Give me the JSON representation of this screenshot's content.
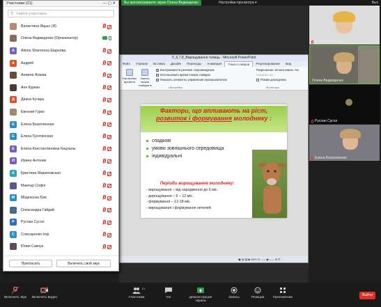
{
  "topbar": {
    "share_badge": "Вы просматриваете экран Олена Ведмеденко",
    "view_options": "Настройки просмотра ▾",
    "window_controls": "— ▢ ✕",
    "fullscreen_label": "Вых"
  },
  "participants": {
    "title": "Участники (21)",
    "window_controls": "— ▢ ✕",
    "search_placeholder": "Найти участника",
    "list": [
      {
        "name": "Валентина Яцько (Я)",
        "initial": "",
        "color": "#b88a6e",
        "status": "muted",
        "photo": true
      },
      {
        "name": "Олена Ведмеденко (Организатор)",
        "initial": "",
        "color": "#8a6a5a",
        "status": "active",
        "photo": true
      },
      {
        "name": "Aliona Sharonova Шарнова",
        "initial": "A",
        "color": "#7b5cc4",
        "status": "muted"
      },
      {
        "name": "Андрей",
        "initial": "А",
        "color": "#d9532c",
        "status": "muted"
      },
      {
        "name": "Анжела Агаева",
        "initial": "",
        "color": "#6a4a3a",
        "status": "muted",
        "photo": true
      },
      {
        "name": "Аня Куркан",
        "initial": "",
        "color": "#4a3a3a",
        "status": "muted",
        "photo": true
      },
      {
        "name": "Диана Кучарь",
        "initial": "Д",
        "color": "#d9532c",
        "status": "muted"
      },
      {
        "name": "Евгения Гурко",
        "initial": "",
        "color": "#9a8a7a",
        "status": "muted",
        "photo": true
      },
      {
        "name": "Елена Безатлинная",
        "initial": "Е",
        "color": "#2a8fc4",
        "status": "muted"
      },
      {
        "name": "Елена Гусятинская",
        "initial": "Е",
        "color": "#2a8fc4",
        "status": "muted"
      },
      {
        "name": "Елена Константиновна Кицлалы",
        "initial": "Е",
        "color": "#7b5cc4",
        "status": "muted"
      },
      {
        "name": "Ирина Антоник",
        "initial": "И",
        "color": "#7b5cc4",
        "status": "muted"
      },
      {
        "name": "Кристина Мажиловская",
        "initial": "К",
        "color": "#2aa8b4",
        "status": "muted"
      },
      {
        "name": "Мамчур Софія",
        "initial": "",
        "color": "#5a5a8a",
        "status": "muted",
        "photo": true
      },
      {
        "name": "Міщенська Єва",
        "initial": "М",
        "color": "#2a8fc4",
        "status": "muted"
      },
      {
        "name": "Олександра Гайдай",
        "initial": "",
        "color": "#4a6a8a",
        "status": "muted",
        "photo": true
      },
      {
        "name": "Руслан Сусол",
        "initial": "Р",
        "color": "#2a6fc4",
        "status": "muted"
      },
      {
        "name": "Слюсаренко Ігор",
        "initial": "С",
        "color": "#2a8fc4",
        "status": "muted"
      },
      {
        "name": "Юлия Савчук",
        "initial": "",
        "color": "#5a4a5a",
        "status": "muted",
        "photo": true
      }
    ],
    "invite_label": "Пригласить",
    "unmute_self_label": "Включить свой звук"
  },
  "ppt": {
    "window_title": "Л_6,7,8_Вирощування телиць - Microsoft PowerPoint",
    "tabs": [
      "Файл",
      "Главная",
      "Вставка",
      "Дизайн",
      "Переходы",
      "Анимация",
      "Показ слайдов",
      "Рецензирование",
      "Вид"
    ],
    "ribbon": {
      "rehearse": "Настройка времени",
      "record": "Запись показа слайдов ▾",
      "chk_narration": "Воспроизвести речевое сопровождение",
      "chk_timings": "Использовать время показа слайдов",
      "chk_controls": "Показать элементы управления проигрывателем",
      "resolution": "Разрешение: Использовать тек",
      "show_on": "Показать на:",
      "presenter_view": "Режим докладчика",
      "group_setup": "Настройка",
      "group_monitors": "Мониторы"
    },
    "slide": {
      "title_prefix": "Фактори, що впливають на ріст, ",
      "title_underlined": "розвиток і формування",
      "title_suffix": " молодняку :",
      "bullets": [
        "спадкові",
        "умови зовнішнього середовища",
        "індивідуальні"
      ],
      "periods_title": "Періоди вирощування молодняку:",
      "periods": [
        "- вирощування – від народження до 6 міс.",
        "- дорощування – 6 – 12 міс.",
        "- формування – 12-18 міс.",
        "- вирощування і формування нетелей"
      ]
    },
    "status": "▣ ▤ ▥ ▶  65%  ⊖ ——◆—— ⊕ ⊡"
  },
  "videos": [
    {
      "name": "Валентина Яцько",
      "bg": "#dcdcdc"
    },
    {
      "name": "Олена Ведмеденко",
      "bg": "#6d6a62"
    },
    {
      "name": "Руслан Сусол",
      "bg": "#111111"
    },
    {
      "name": "Елена Безатлинная",
      "bg": "#7a7a80"
    }
  ],
  "toolbar": {
    "mute": "Включить звук",
    "video": "Включить видео",
    "participants": "Участники",
    "participants_count": "21",
    "chat": "Чат",
    "share": "Демонстрация экрана",
    "record": "Запись",
    "reactions": "Реакции",
    "apps": "Приложения",
    "end": "Выйти"
  },
  "colors": {
    "accent_green": "#2e8b3e",
    "end_red": "#e0302a",
    "muted_red": "#dd3333"
  }
}
